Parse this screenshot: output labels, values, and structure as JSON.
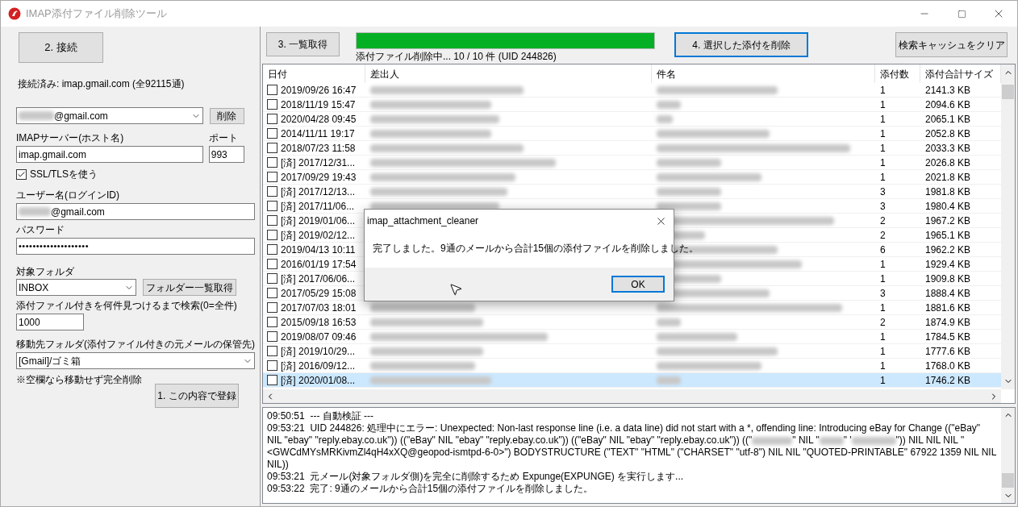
{
  "window": {
    "title": "IMAP添付ファイル削除ツール"
  },
  "left_panel": {
    "connect_button": "2. 接続",
    "status": "接続済み: imap.gmail.com (全92115通)",
    "account_suffix": "@gmail.com",
    "account_delete_button": "削除",
    "server_label": "IMAPサーバー(ホスト名)",
    "server_value": "imap.gmail.com",
    "port_label": "ポート",
    "port_value": "993",
    "ssl": {
      "label": "SSL/TLSを使う",
      "checked": true
    },
    "user_label": "ユーザー名(ログインID)",
    "user_suffix": "@gmail.com",
    "password_label": "パスワード",
    "password_value": "••••••••••••••••••••",
    "folder_label": "対象フォルダ",
    "folder_value": "INBOX",
    "folder_list_button": "フォルダー一覧取得",
    "search_label": "添付ファイル付きを何件見つけるまで検索(0=全件)",
    "search_value": "1000",
    "move_label": "移動先フォルダ(添付ファイル付きの元メールの保管先)",
    "move_value": "[Gmail]/ゴミ箱",
    "note": "※空欄なら移動せず完全削除",
    "save_button": "1. この内容で登録"
  },
  "toolbar": {
    "fetch_button": "3. 一覧取得",
    "progress": {
      "level": 1,
      "text": "添付ファイル削除中... 10 / 10 件 (UID 244826)"
    },
    "delete_button": {
      "label": "4. 選択した添付を削除",
      "focused": true
    },
    "clear_cache_button": "検索キャッシュをクリア"
  },
  "table": {
    "columns": [
      "日付",
      "差出人",
      "件名",
      "添付数",
      "添付合計サイズ"
    ],
    "rows": [
      {
        "date": "2019/09/26 16:47",
        "count": "1",
        "size": "2141.3 KB",
        "checked": false,
        "selected": false
      },
      {
        "date": "2018/11/19 15:47",
        "count": "1",
        "size": "2094.6 KB",
        "checked": false,
        "selected": false
      },
      {
        "date": "2020/04/28 09:45",
        "count": "1",
        "size": "2065.1 KB",
        "checked": false,
        "selected": false
      },
      {
        "date": "2014/11/11 19:17",
        "count": "1",
        "size": "2052.8 KB",
        "checked": false,
        "selected": false
      },
      {
        "date": "2018/07/23 11:58",
        "count": "1",
        "size": "2033.3 KB",
        "checked": false,
        "selected": false
      },
      {
        "date": "[済] 2017/12/31...",
        "count": "1",
        "size": "2026.8 KB",
        "checked": false,
        "selected": false
      },
      {
        "date": "2017/09/29 19:43",
        "count": "1",
        "size": "2021.8 KB",
        "checked": false,
        "selected": false
      },
      {
        "date": "[済] 2017/12/13...",
        "count": "3",
        "size": "1981.8 KB",
        "checked": false,
        "selected": false
      },
      {
        "date": "[済] 2017/11/06...",
        "count": "3",
        "size": "1980.4 KB",
        "checked": false,
        "selected": false
      },
      {
        "date": "[済] 2019/01/06...",
        "count": "2",
        "size": "1967.2 KB",
        "checked": false,
        "selected": false
      },
      {
        "date": "[済] 2019/02/12...",
        "count": "2",
        "size": "1965.1 KB",
        "checked": false,
        "selected": false
      },
      {
        "date": "2019/04/13 10:11",
        "count": "6",
        "size": "1962.2 KB",
        "checked": false,
        "selected": false
      },
      {
        "date": "2016/01/19 17:54",
        "count": "1",
        "size": "1929.4 KB",
        "checked": false,
        "selected": false
      },
      {
        "date": "[済] 2017/06/06...",
        "count": "1",
        "size": "1909.8 KB",
        "checked": false,
        "selected": false
      },
      {
        "date": "2017/05/29 15:08",
        "count": "3",
        "size": "1888.4 KB",
        "checked": false,
        "selected": false
      },
      {
        "date": "2017/07/03 18:01",
        "count": "1",
        "size": "1881.6 KB",
        "checked": false,
        "selected": false
      },
      {
        "date": "2015/09/18 16:53",
        "count": "2",
        "size": "1874.9 KB",
        "checked": false,
        "selected": false
      },
      {
        "date": "2019/08/07 09:46",
        "count": "1",
        "size": "1784.5 KB",
        "checked": false,
        "selected": false
      },
      {
        "date": "[済] 2019/10/29...",
        "count": "1",
        "size": "1777.6 KB",
        "checked": false,
        "selected": false
      },
      {
        "date": "[済] 2016/09/12...",
        "count": "1",
        "size": "1768.0 KB",
        "checked": false,
        "selected": false
      },
      {
        "date": "[済] 2020/01/08...",
        "count": "1",
        "size": "1746.2 KB",
        "checked": false,
        "selected": true
      }
    ]
  },
  "log": [
    {
      "time": "09:50:51",
      "parts": [
        "--- 自動検証 ---"
      ]
    },
    {
      "time": "09:53:21",
      "parts": [
        "UID 244826: 処理中にエラー: Unexpected: Non-last response line (i.e. a data line) did not start with a *, offending line: Introducing eBay for Change ((\"eBay\" NIL \"ebay\" \"reply.ebay.co.uk\")) ((\"eBay\" NIL \"ebay\" \"reply.ebay.co.uk\")) ((\"eBay\" NIL \"ebay\" \"reply.ebay.co.uk\")) ((\"",
        "\" NIL \"",
        "\" '",
        "\")) NIL NIL NIL \"<GWCdMYsMRKivmZl4qH4xXQ@geopod-ismtpd-6-0>\") BODYSTRUCTURE (\"TEXT\" \"HTML\" (\"CHARSET\" \"utf-8\") NIL NIL \"QUOTED-PRINTABLE\" 67922 1359 NIL NIL NIL))"
      ]
    },
    {
      "time": "09:53:21",
      "parts": [
        "元メール(対象フォルダ側)を完全に削除するため Expunge(EXPUNGE) を実行します..."
      ]
    },
    {
      "time": "09:53:22",
      "parts": [
        "完了: 9通のメールから合計15個の添付ファイルを削除しました。"
      ]
    }
  ],
  "dialog": {
    "title": "imap_attachment_cleaner",
    "message": "完了しました。9通のメールから合計15個の添付ファイルを削除しました。",
    "ok_button": "OK"
  }
}
